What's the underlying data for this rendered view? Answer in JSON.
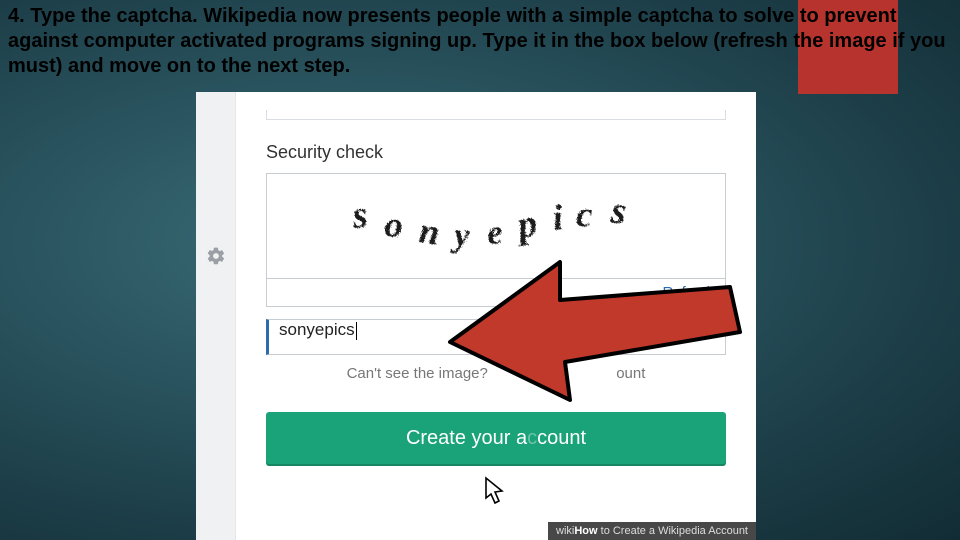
{
  "instruction": "4. Type the captcha. Wikipedia now presents people with a simple captcha to solve to prevent against computer activated programs signing up. Type it in the box below (refresh the image if you must) and move on to the next step.",
  "security": {
    "label": "Security check",
    "captcha_text": "sonyepics",
    "refresh_label": "Refresh",
    "input_value": "sonyepics",
    "help_text_left": "Can't see the image? ",
    "help_text_right": "ount"
  },
  "create_button_left": "Create your a",
  "create_button_right": "count",
  "attribution_prefix": "wiki",
  "attribution_bold": "How",
  "attribution_rest": " to Create a Wikipedia Account"
}
